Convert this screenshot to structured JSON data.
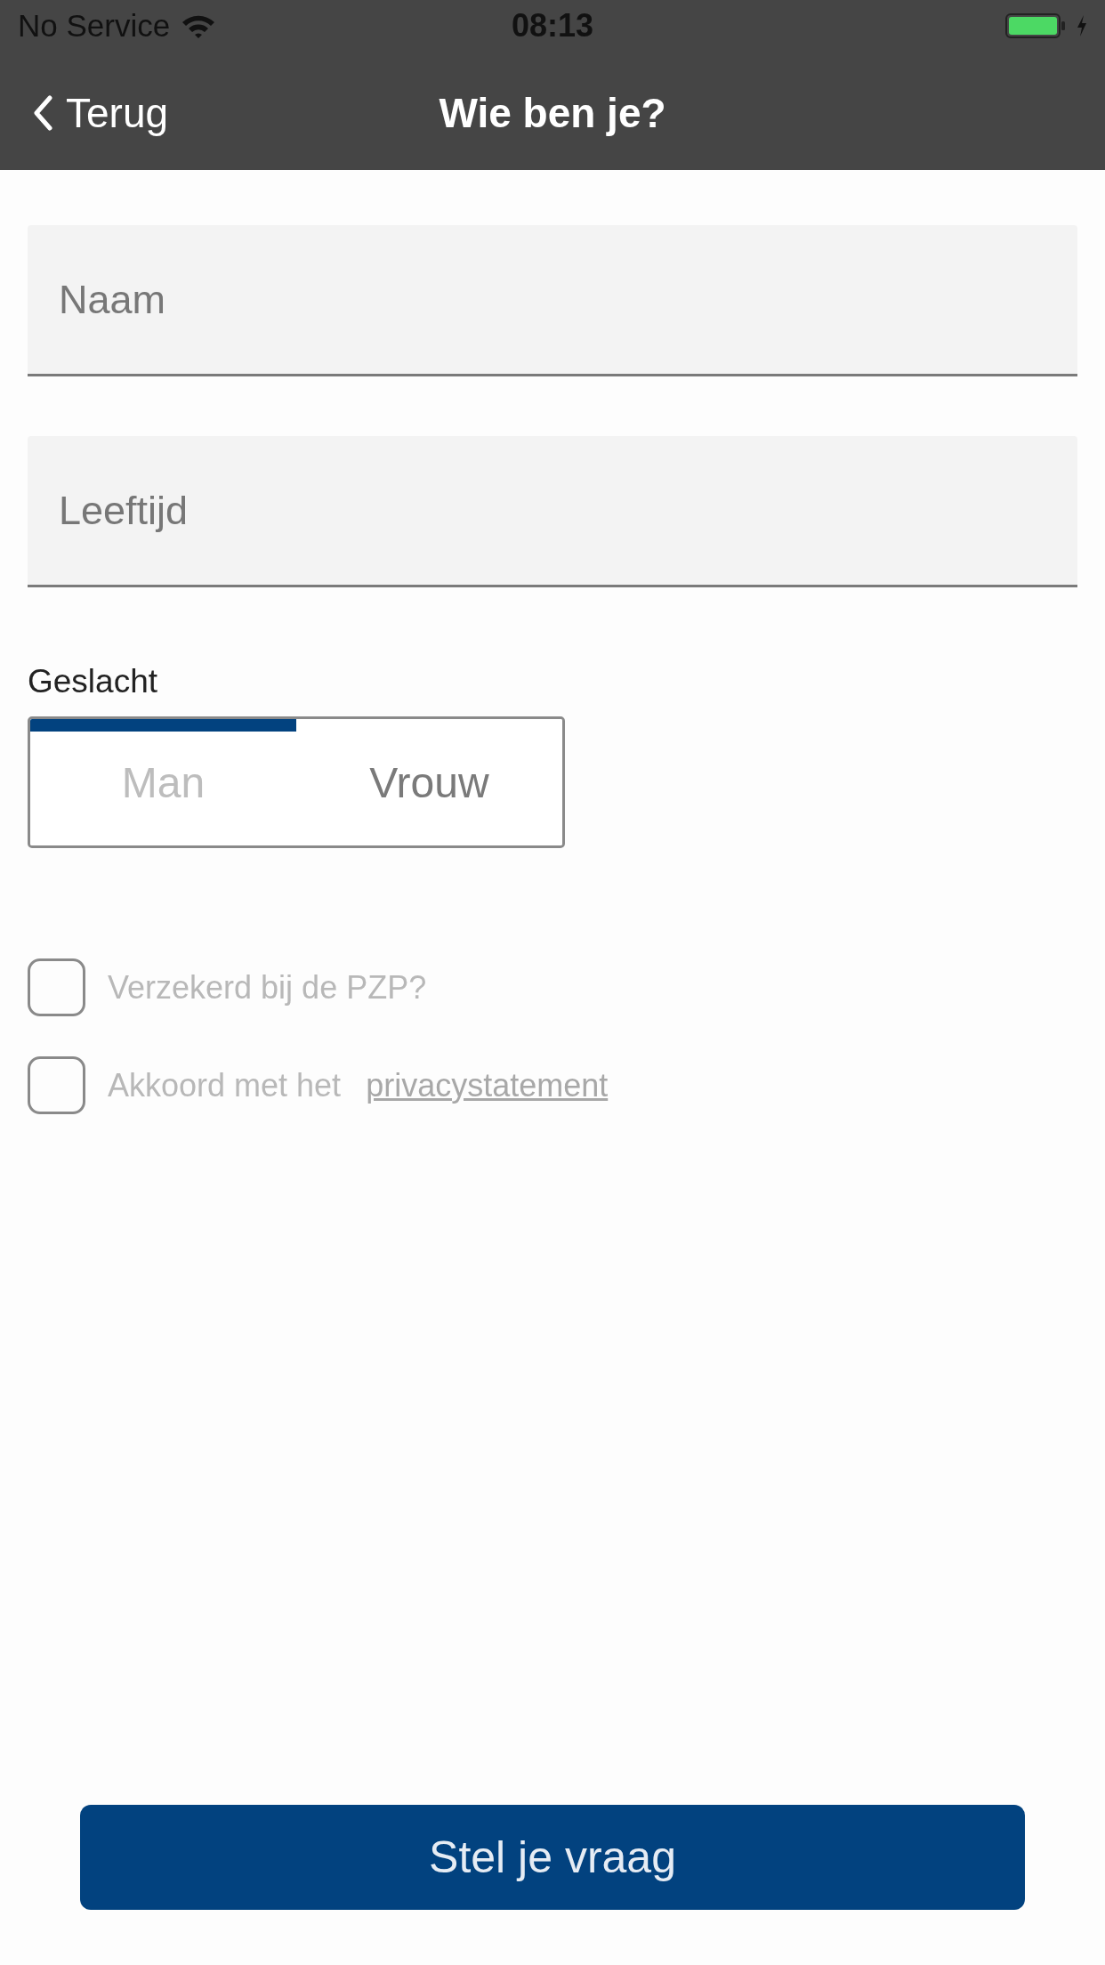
{
  "status_bar": {
    "carrier": "No Service",
    "time": "08:13",
    "charging": true
  },
  "nav": {
    "back": "Terug",
    "title": "Wie ben je?"
  },
  "fields": [
    {
      "placeholder": "Naam"
    },
    {
      "placeholder": "Leeftijd"
    }
  ],
  "gender": {
    "label": "Geslacht",
    "options": [
      {
        "label": "Man",
        "selected": true
      },
      {
        "label": "Vrouw",
        "selected": false
      }
    ]
  },
  "checkboxes": [
    {
      "label": "Verzekerd bij de PZP?",
      "checked": false
    },
    {
      "label": "Akkoord met het",
      "link": "privacystatement",
      "checked": false
    }
  ],
  "submit": "Stel je vraag"
}
